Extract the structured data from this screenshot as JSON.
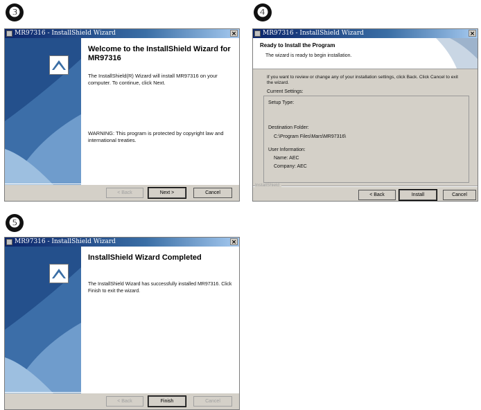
{
  "steps": [
    "❸",
    "❹",
    "❺"
  ],
  "window_title": "MR97316 - InstallShield Wizard",
  "close_glyph": "×",
  "welcome": {
    "heading_line1": "Welcome to the InstallShield Wizard for",
    "heading_line2": "MR97316",
    "para1_line1": "The InstallShield(R) Wizard will install MR97316 on your",
    "para1_line2": "computer. To continue, click Next.",
    "warning_line1": "WARNING: This program is protected by copyright law and",
    "warning_line2": "international treaties.",
    "buttons": {
      "back": "< Back",
      "next": "Next >",
      "cancel": "Cancel"
    }
  },
  "ready": {
    "heading": "Ready to Install the Program",
    "subheading": "The wizard is ready to begin installation.",
    "instruction_line1": "If you want to review or change any of your installation settings, click Back. Click Cancel to exit",
    "instruction_line2": "the wizard.",
    "current_settings": "Current Settings:",
    "setup_type": "Setup Type:",
    "destination_label": "Destination Folder:",
    "destination_value": "C:\\Program Files\\Mars\\MR97316\\",
    "user_info": "User Information:",
    "name": "Name: AEC",
    "company": "Company: AEC",
    "footer_brand": "InstallShield",
    "buttons": {
      "back": "< Back",
      "install": "Install",
      "cancel": "Cancel"
    }
  },
  "completed": {
    "heading": "InstallShield Wizard Completed",
    "para_line1": "The InstallShield Wizard has successfully installed MR97316. Click",
    "para_line2": "Finish to exit the wizard.",
    "buttons": {
      "back": "< Back",
      "finish": "Finish",
      "cancel": "Cancel"
    }
  }
}
